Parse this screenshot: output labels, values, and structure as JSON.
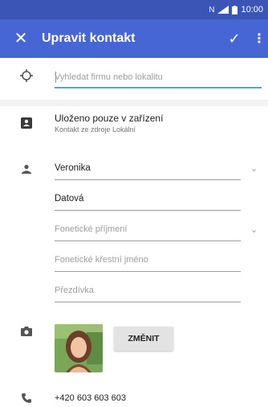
{
  "status_bar": {
    "time": "10:00",
    "indicators": "N",
    "icons": [
      "nfc-icon",
      "signal-icon",
      "battery-icon"
    ]
  },
  "app_bar": {
    "title": "Upravit kontakt",
    "close_icon": "close-icon",
    "save_icon": "check-icon",
    "more_icon": "more-vert-icon"
  },
  "search": {
    "placeholder": "Vyhledat firmu nebo lokalitu",
    "icon": "location-target-icon"
  },
  "account": {
    "title": "Uloženo pouze v zařízení",
    "subtitle": "Kontakt ze zdroje Lokální",
    "icon": "contact-card-icon"
  },
  "name_fields": [
    {
      "value": "Veronika",
      "placeholder": ""
    },
    {
      "value": "Datová",
      "placeholder": ""
    },
    {
      "value": "",
      "placeholder": "Fonetické příjmení"
    },
    {
      "value": "",
      "placeholder": "Fonetické křestní jméno"
    },
    {
      "value": "",
      "placeholder": "Přezdívka"
    }
  ],
  "photo": {
    "change_label": "ZMĚNIT",
    "icon": "camera-icon"
  },
  "phone": {
    "value": "+420 603 603 603",
    "icon": "phone-icon"
  },
  "colors": {
    "status_bar": "#3a55b5",
    "app_bar": "#4666d6",
    "accent": "#3cb4c8"
  }
}
